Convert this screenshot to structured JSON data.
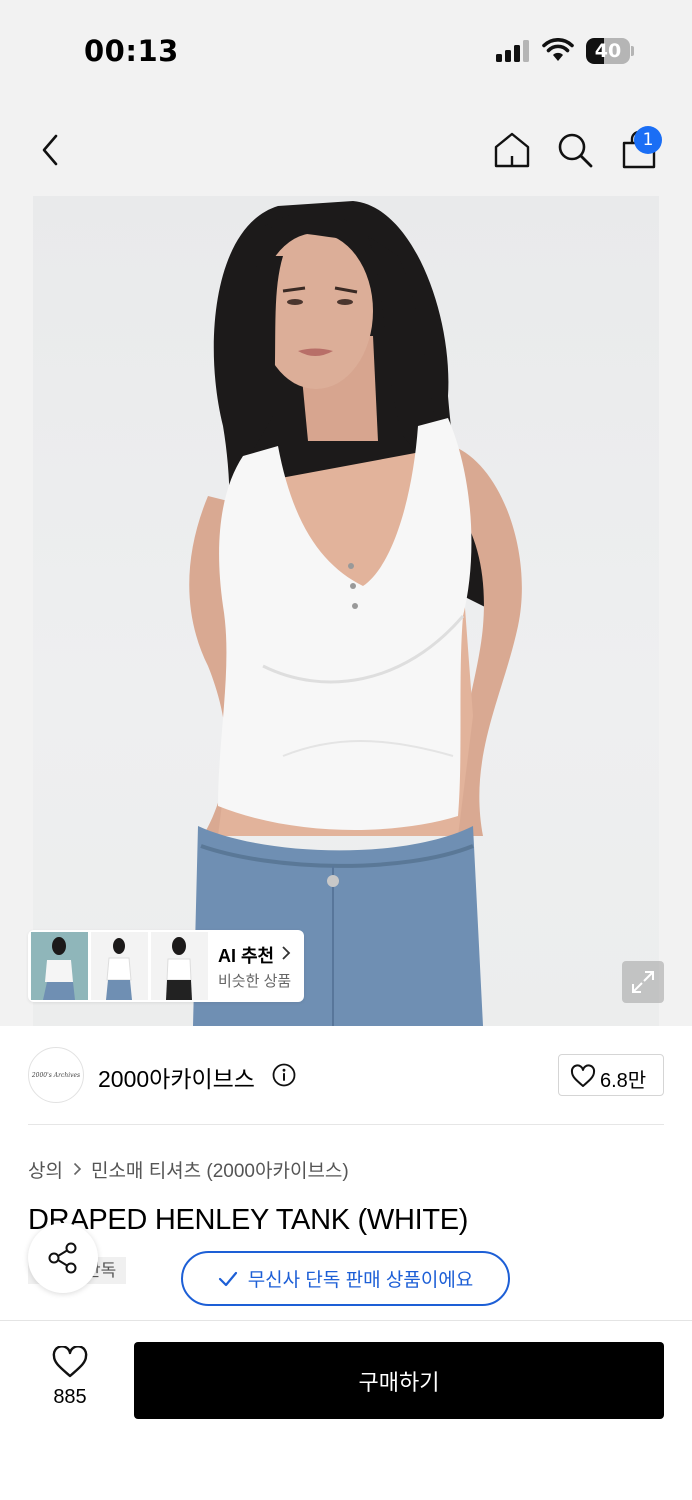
{
  "status_bar": {
    "time": "00:13",
    "battery_percent": "40",
    "battery_level": 0.4
  },
  "nav": {
    "cart_badge_count": "1",
    "icons": [
      "back-arrow-icon",
      "home-icon",
      "search-icon",
      "shopping-bag-icon"
    ]
  },
  "ai_recommend": {
    "title": "AI 추천",
    "subtitle": "비슷한 상품"
  },
  "brand": {
    "logo_text": "2000's Archives",
    "name": "2000아카이브스",
    "likes": "6.8만"
  },
  "breadcrumb": {
    "category": "상의",
    "subcategory": "민소매 티셔츠 (2000아카이브스)"
  },
  "product": {
    "title": "DRAPED HENLEY TANK (WHITE)",
    "tag": "단독"
  },
  "toast": {
    "message": "무신사 단독 판매 상품이에요"
  },
  "bottom_bar": {
    "wish_count": "885",
    "buy_label": "구매하기"
  },
  "colors": {
    "accent_blue": "#1d5fd6",
    "badge_blue": "#1a6ef5",
    "buy_button": "#000000"
  }
}
